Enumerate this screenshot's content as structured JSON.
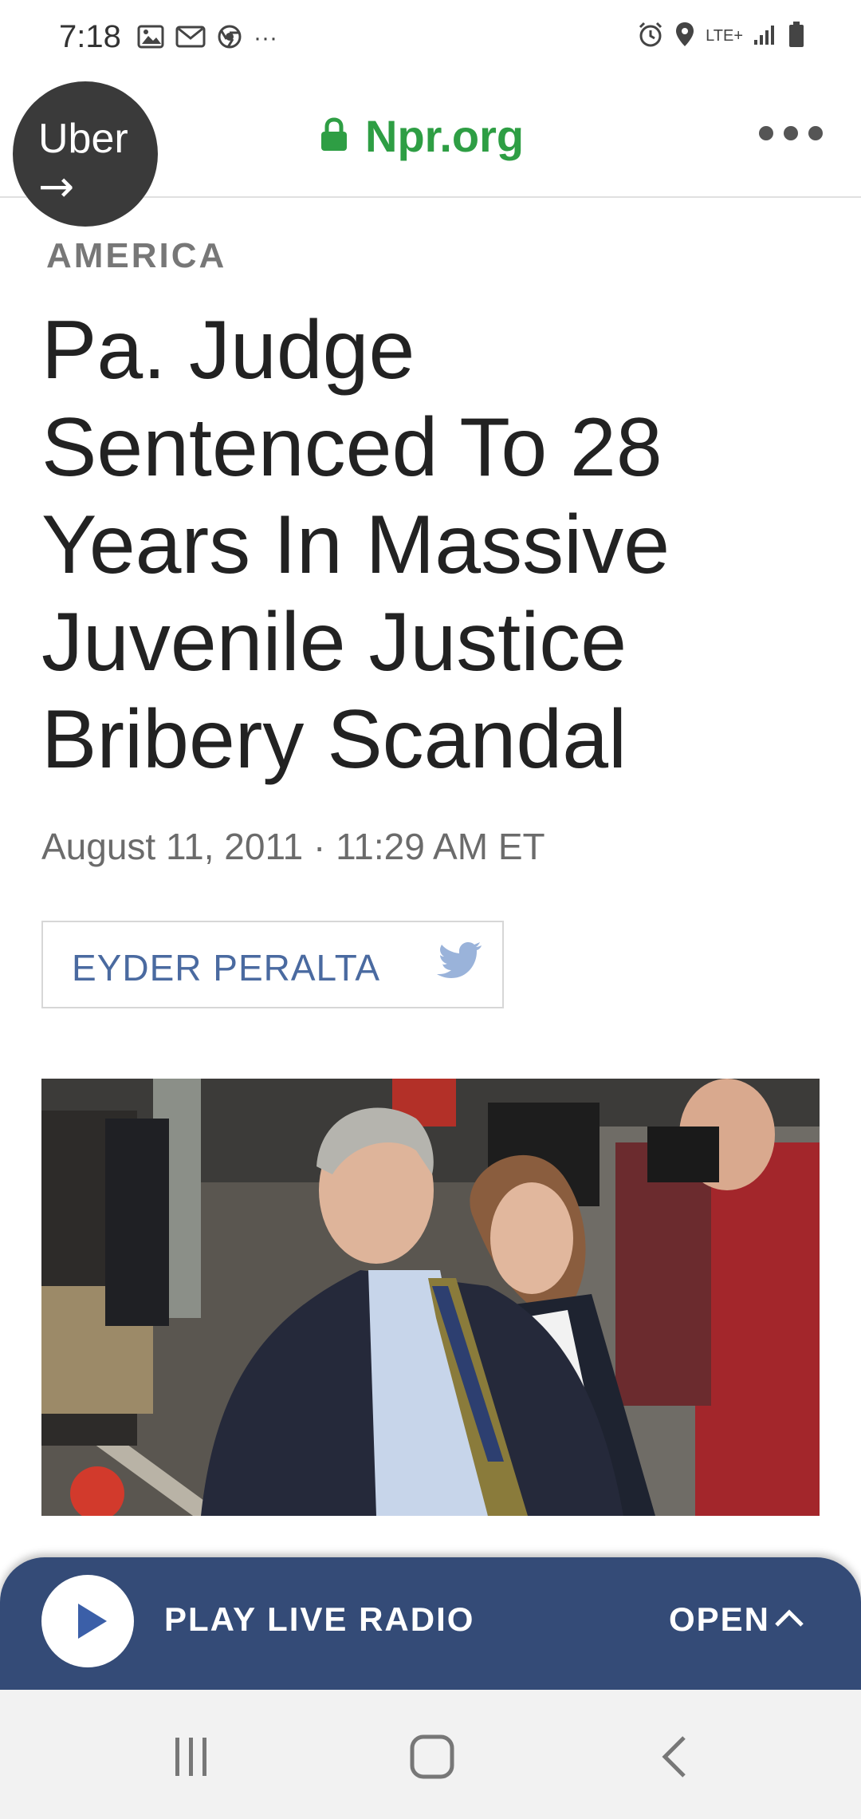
{
  "status_bar": {
    "time": "7:18",
    "overflow": "···",
    "network": "LTE+",
    "left_icons": [
      "image-icon",
      "gmail-icon",
      "chrome-icon"
    ],
    "right_icons": [
      "alarm-icon",
      "location-icon",
      "lte-icon",
      "signal-icon",
      "battery-icon"
    ]
  },
  "address_bar": {
    "url": "Npr.org",
    "secure": true,
    "url_color": "#2e9e44"
  },
  "uber_bubble": {
    "label": "Uber",
    "arrow": "→"
  },
  "article": {
    "section": "AMERICA",
    "headline_lines": [
      "Pa. Judge",
      "Sentenced To 28",
      "Years In Massive",
      "Juvenile Justice",
      "Bribery Scandal"
    ],
    "date": "August 11, 2011 · 11:29 AM ET",
    "author": "EYDER PERALTA",
    "author_color": "#4a6aa0"
  },
  "radio_bar": {
    "play_label": "PLAY LIVE RADIO",
    "open_label": "OPEN",
    "bar_color": "#344b77"
  },
  "nav_bar": {
    "icons": [
      "recent-apps-icon",
      "home-icon",
      "back-icon"
    ]
  }
}
